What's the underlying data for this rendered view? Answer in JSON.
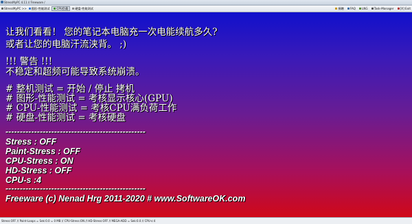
{
  "window": {
    "title": "StressMyPC 4.11 // Freeware /"
  },
  "menubar": {
    "left_items": [
      {
        "label": "StressMyPC >>",
        "icon": "app-icon"
      },
      {
        "label": "图形-性能测试",
        "icon": "graphics-icon"
      },
      {
        "label": "CPU负载",
        "icon": "cpu-icon"
      },
      {
        "label": "硬盘-性能测试",
        "icon": "disk-icon"
      }
    ],
    "right_items": [
      {
        "label": "捐赠",
        "icon": "donate-icon"
      },
      {
        "label": "FAQ",
        "icon": "help-icon"
      },
      {
        "label": "LNG",
        "icon": "language-icon"
      },
      {
        "label": "Task-Manager",
        "icon": "task-manager-icon"
      },
      {
        "label": "[X] Exit",
        "icon": "exit-icon"
      }
    ]
  },
  "main": {
    "intro_line1": "让我们看看！ 您的笔记本电脑充一次电能续航多久?",
    "intro_line2": "或者让您的电脑汗流浃背。 ;)",
    "warning_title": "!!! 警告 !!!",
    "warning_text": "不稳定和超频可能导致系统崩溃。",
    "hotkey1": "# 整机测试 = 开始 / 停止 拷机",
    "hotkey2": "# 图形-性能测试 = 考核显示核心(GPU)",
    "hotkey3": "# CPU-性能测试 = 考核CPU满负荷工作",
    "hotkey4": "# 硬盘-性能测试 = 考核硬盘",
    "separator": "-------------------------------------------------",
    "status": {
      "stress": "Stress : OFF",
      "paint_stress": "Paint-Stress : OFF",
      "cpu_stress": "CPU-Stress : ON",
      "hd_stress": "HD-Stress : OFF",
      "cpus": "CPU-s :4"
    },
    "footer": "Freeware (c) Nenad Hrg 2011-2020 # www.SoftwareOK.com"
  },
  "statusbar": {
    "text": "Stress:OFF // Paint-Loops = Sek:0.0 = 0 MB // CPU-Stress:ON // HD-Stress:OFF // MEGA-ADD = Sek:0.0 // CPU-s:4"
  },
  "colors": {
    "gradient_top": "#1010cc",
    "gradient_bottom": "#d00818",
    "text": "#ffffff"
  }
}
